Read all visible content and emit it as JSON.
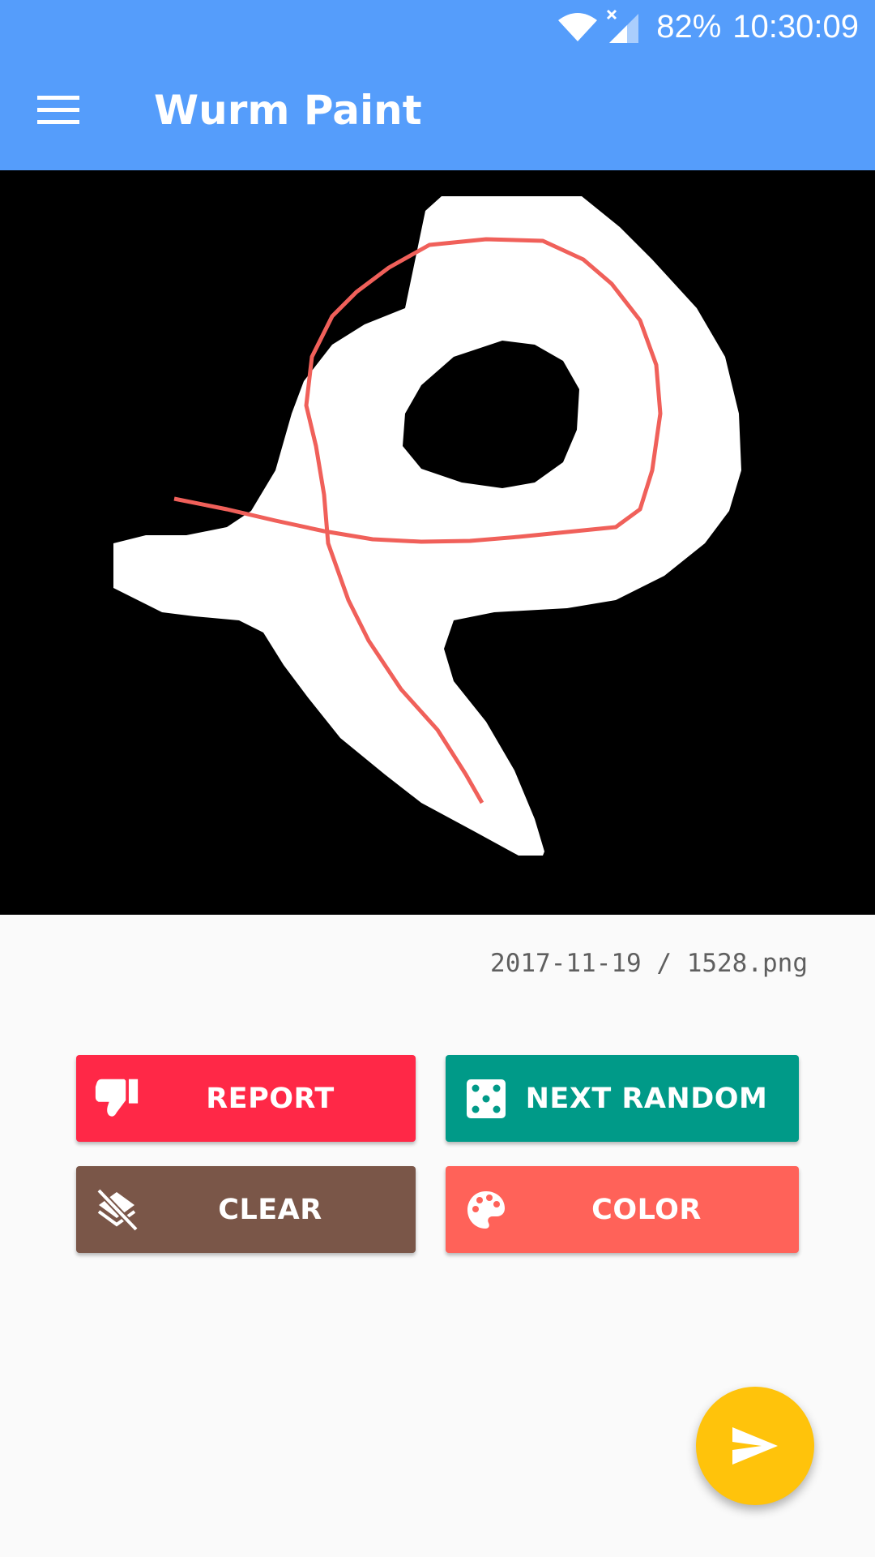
{
  "status_bar": {
    "battery": "82%",
    "time": "10:30:09",
    "icons": [
      "wifi-icon",
      "cell-signal-no-service-icon"
    ]
  },
  "app_bar": {
    "title": "Wurm Paint",
    "menu_icon": "hamburger-menu-icon"
  },
  "canvas": {
    "background_color": "#000000",
    "shape_color": "#ffffff",
    "stroke_color": "#f0605a"
  },
  "file_info": {
    "date": "2017-11-19",
    "separator": " / ",
    "filename": "1528.png"
  },
  "buttons": {
    "report": {
      "label": "REPORT",
      "icon": "thumb-down-icon",
      "color": "#ff2847"
    },
    "next_random": {
      "label": "NEXT RANDOM",
      "icon": "dice-icon",
      "color": "#009a88"
    },
    "clear": {
      "label": "CLEAR",
      "icon": "layers-clear-icon",
      "color": "#7a5648"
    },
    "color": {
      "label": "COLOR",
      "icon": "palette-icon",
      "color": "#ff6259"
    }
  },
  "fab": {
    "icon": "send-icon",
    "color": "#ffc30b"
  },
  "theme": {
    "app_bar_color": "#559dfb",
    "background": "#fafafa"
  }
}
